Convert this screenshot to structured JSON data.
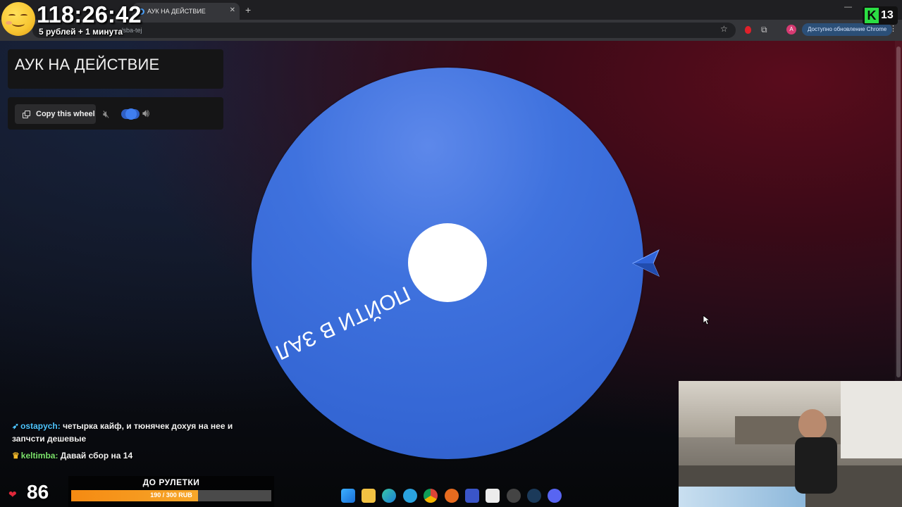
{
  "overlay": {
    "timer": "118:26:42",
    "timer_subtitle": "5 рублей + 1 минута",
    "viewer_count": "13"
  },
  "browser": {
    "tab_title": "АУК НА ДЕЙСТВИЕ",
    "url_partial": "/sba-tej",
    "update_text": "Доступно обновление Chrome",
    "profile_initial": "A"
  },
  "page": {
    "title": "АУК НА ДЕЙСТВИЕ",
    "copy_button": "Copy this wheel"
  },
  "wheel": {
    "segment_label": "ПОЙТИ В ЗАЛ",
    "color": "#3f72de"
  },
  "chat": [
    {
      "user": "ostapych:",
      "text": " четырка кайф, и тюнячек дохуя на нее и запчсти дешевые"
    },
    {
      "user": "keltimba:",
      "text": " Давай сбор на 14"
    }
  ],
  "goal": {
    "title": "ДО РУЛЕТКИ",
    "label": "190 / 300 RUB",
    "progress": 0.633
  },
  "stream": {
    "subs_count": "86"
  },
  "icons": [
    "minimize-icon",
    "star-icon",
    "puzzle-icon",
    "mute-icon",
    "volume-icon",
    "copy-icon",
    "pointer-icon",
    "cursor-icon"
  ]
}
